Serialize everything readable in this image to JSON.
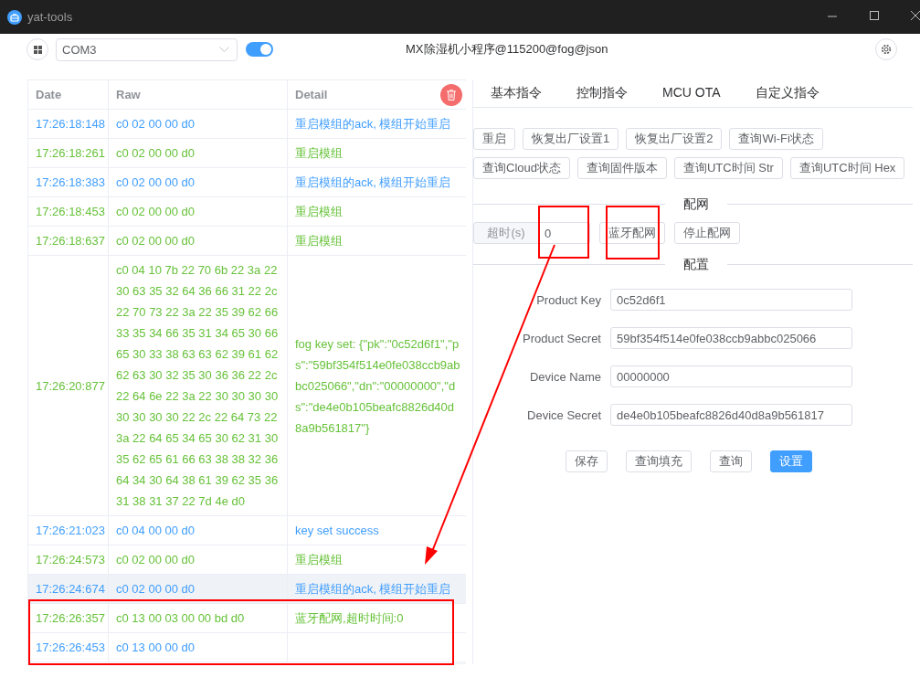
{
  "window": {
    "title": "yat-tools"
  },
  "toolbar": {
    "port": "COM3",
    "connected": true,
    "status": "MX除湿机小程序@115200@fog@json"
  },
  "log": {
    "columns": [
      "Date",
      "Raw",
      "Detail"
    ],
    "rows": [
      {
        "kind": "rx",
        "hovered": false,
        "date": "17:26:18:148",
        "raw": "c0 02 00 00 d0",
        "detail": "重启模组的ack, 模组开始重启"
      },
      {
        "kind": "tx",
        "hovered": false,
        "date": "17:26:18:261",
        "raw": "c0 02 00 00 d0",
        "detail": "重启模组"
      },
      {
        "kind": "rx",
        "hovered": false,
        "date": "17:26:18:383",
        "raw": "c0 02 00 00 d0",
        "detail": "重启模组的ack, 模组开始重启"
      },
      {
        "kind": "tx",
        "hovered": false,
        "date": "17:26:18:453",
        "raw": "c0 02 00 00 d0",
        "detail": "重启模组"
      },
      {
        "kind": "tx",
        "hovered": false,
        "date": "17:26:18:637",
        "raw": "c0 02 00 00 d0",
        "detail": "重启模组"
      },
      {
        "kind": "tx",
        "hovered": false,
        "date": "17:26:20:877",
        "raw": "c0 04 10 7b 22 70 6b 22 3a 22 30 63 35 32 64 36 66 31 22 2c 22 70 73 22 3a 22 35 39 62 66 33 35 34 66 35 31 34 65 30 66 65 30 33 38 63 63 62 39 61 62 62 63 30 32 35 30 36 36 22 2c 22 64 6e 22 3a 22 30 30 30 30 30 30 30 30 22 2c 22 64 73 22 3a 22 64 65 34 65 30 62 31 30 35 62 65 61 66 63 38 38 32 36 64 34 30 64 38 61 39 62 35 36 31 38 31 37 22 7d 4e d0",
        "detail": "fog key set: {\"pk\":\"0c52d6f1\",\"ps\":\"59bf354f514e0fe038ccb9abbc025066\",\"dn\":\"00000000\",\"ds\":\"de4e0b105beafc8826d40d8a9b561817\"}"
      },
      {
        "kind": "rx",
        "hovered": false,
        "date": "17:26:21:023",
        "raw": "c0 04 00 00 d0",
        "detail": "key set success"
      },
      {
        "kind": "tx",
        "hovered": false,
        "date": "17:26:24:573",
        "raw": "c0 02 00 00 d0",
        "detail": "重启模组"
      },
      {
        "kind": "rx",
        "hovered": true,
        "date": "17:26:24:674",
        "raw": "c0 02 00 00 d0",
        "detail": "重启模组的ack, 模组开始重启"
      },
      {
        "kind": "tx",
        "hovered": false,
        "date": "17:26:26:357",
        "raw": "c0 13 00 03 00 00 bd d0",
        "detail": "蓝牙配网,超时时间:0"
      },
      {
        "kind": "rx",
        "hovered": false,
        "date": "17:26:26:453",
        "raw": "c0 13 00 00 d0",
        "detail": ""
      }
    ]
  },
  "tabs": [
    {
      "label": "基本指令"
    },
    {
      "label": "控制指令"
    },
    {
      "label": "MCU OTA"
    },
    {
      "label": "自定义指令"
    }
  ],
  "commands": [
    "重启",
    "恢复出厂设置1",
    "恢复出厂设置2",
    "查询Wi-Fi状态",
    "查询Cloud状态",
    "查询固件版本",
    "查询UTC时间 Str",
    "查询UTC时间 Hex"
  ],
  "network": {
    "title": "配网",
    "timeout_label": "超时(s)",
    "timeout": "0",
    "buttons": [
      "蓝牙配网",
      "停止配网"
    ]
  },
  "config": {
    "title": "配置",
    "fields": [
      {
        "label": "Product Key",
        "value": "0c52d6f1"
      },
      {
        "label": "Product Secret",
        "value": "59bf354f514e0fe038ccb9abbc025066"
      },
      {
        "label": "Device Name",
        "value": "00000000"
      },
      {
        "label": "Device Secret",
        "value": "de4e0b105beafc8826d40d8a9b561817"
      }
    ],
    "buttons": [
      {
        "label": "保存",
        "primary": false
      },
      {
        "label": "查询填充",
        "primary": false
      },
      {
        "label": "查询",
        "primary": false
      },
      {
        "label": "设置",
        "primary": true
      }
    ]
  }
}
